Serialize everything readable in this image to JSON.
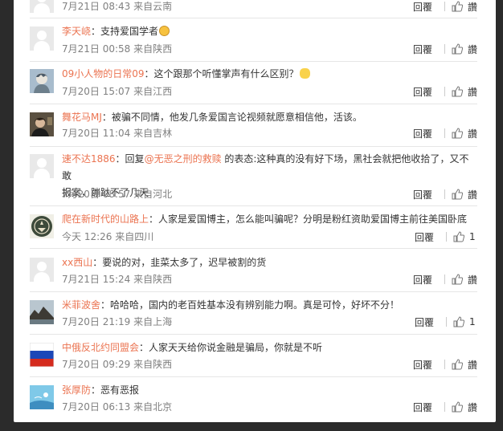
{
  "reply_label": "回覆",
  "like_label": "讚",
  "comments": [
    {
      "user": "",
      "text": "",
      "meta": "7月21日 08:43 来自云南",
      "likes": "讚"
    },
    {
      "user": "李天峣",
      "text": "：支持爱国学者",
      "meta": "7月21日 00:58 来自陕西",
      "likes": "讚",
      "emoji": "nerd-face-emoji"
    },
    {
      "user": "09小人物的日常09",
      "text": "：这个跟那个听懂掌声有什么区别？",
      "meta": "7月20日 15:07 来自江西",
      "likes": "讚",
      "emoji": "bee-emoji"
    },
    {
      "user": "舞花马MJ",
      "text": "：被骗不同情，他发几条爱国言论视频就愿意相信他，活该。",
      "meta": "7月20日 11:04 来自吉林",
      "likes": "讚"
    },
    {
      "user": "速不达1886",
      "text_prefix": "：回复",
      "mention": "@无恶之刑的救赎",
      "text": " 的表态:这种真的没有好下场，黑社会就把他收拾了，又不敢",
      "text2": "报案，蹦跶不了几天",
      "meta": "7月20日 08:57 来自河北",
      "likes": "讚"
    },
    {
      "user": "爬在新时代的山路上",
      "text": "：人家是爱国博主，怎么能叫骗呢？分明是粉红资助爱国博主前往美国卧底",
      "meta": "今天 12:26 来自四川",
      "likes": "1"
    },
    {
      "user": "xx西山",
      "text": "：要说的对，韭菜太多了，迟早被割的货",
      "meta": "7月21日 15:24 来自陕西",
      "likes": "讚"
    },
    {
      "user": "米菲波舍",
      "text": "：哈哈哈，国内的老百姓基本没有辨别能力啊。真是可怜，好坏不分！",
      "meta": "7月20日 21:19 来自上海",
      "likes": "1"
    },
    {
      "user": "中俄反北约同盟会",
      "text": "：人家天天给你说金融是骗局，你就是不听",
      "meta": "7月20日 09:29 来自陕西",
      "likes": "讚"
    },
    {
      "user": "张厚防",
      "text": "：恶有恶报",
      "meta": "7月20日 06:13 来自北京",
      "likes": "讚"
    }
  ],
  "colors": {
    "username": "#eb7350",
    "meta": "#808080",
    "background": "#2b2b2b"
  }
}
